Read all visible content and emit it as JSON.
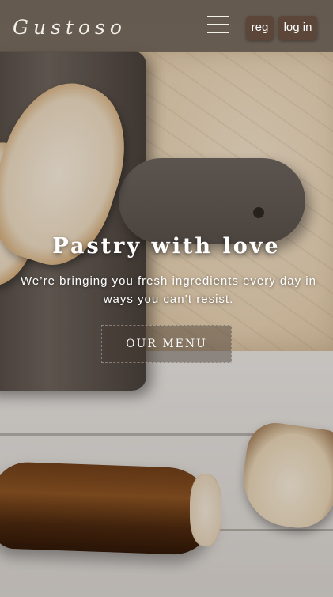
{
  "brand": {
    "logo_text": "Gustoso"
  },
  "header": {
    "menu_icon": "hamburger-icon",
    "reg_label": "reg",
    "login_label": "log in"
  },
  "hero": {
    "title": "Pastry with love",
    "subtitle": "We’re bringing you fresh ingredients every day in ways you can’t resist.",
    "cta_label": "OUR MENU"
  },
  "colors": {
    "header_bg": "#5c5248",
    "button_bg": "#5b4639",
    "text": "#ffffff"
  }
}
